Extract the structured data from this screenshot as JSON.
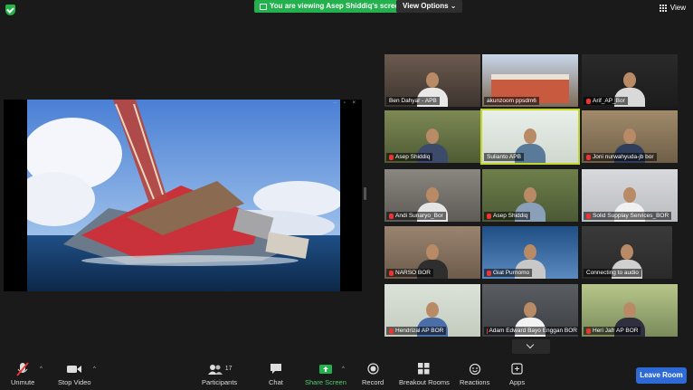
{
  "topbar": {
    "viewing_label": "You are viewing Asep Shiddiq's screen",
    "view_options_label": "View Options",
    "view_label": "View"
  },
  "participants": [
    {
      "name": "Ben Dahyar - APB",
      "muted": false
    },
    {
      "name": "akunzoom ppsdm6",
      "muted": false
    },
    {
      "name": "Arif_AP_Bor",
      "muted": true
    },
    {
      "name": "Asep Shiddiq",
      "muted": true
    },
    {
      "name": "Sulianto APB",
      "muted": false
    },
    {
      "name": "Joni nurwahyuda-jb bor",
      "muted": true
    },
    {
      "name": "Andi Sunaryo_Bor",
      "muted": true
    },
    {
      "name": "Asep Shiddiq",
      "muted": true
    },
    {
      "name": "Solid Supplay Services_BOR",
      "muted": true
    },
    {
      "name": "NARSO BOR",
      "muted": true
    },
    {
      "name": "Giat Purnomo",
      "muted": true
    },
    {
      "name": "Connecting to audio",
      "muted": false
    },
    {
      "name": "Hendrizal AP BOR",
      "muted": true
    },
    {
      "name": "Adam Edward Bayo Enggan BOR",
      "muted": true
    },
    {
      "name": "Heri Jafr AP BOR",
      "muted": true
    }
  ],
  "toolbar": {
    "unmute": "Unmute",
    "stop_video": "Stop Video",
    "participants": "Participants",
    "participants_count": "17",
    "chat": "Chat",
    "share_screen": "Share Screen",
    "record": "Record",
    "breakout_rooms": "Breakout Rooms",
    "reactions": "Reactions",
    "apps": "Apps",
    "leave": "Leave Room"
  }
}
